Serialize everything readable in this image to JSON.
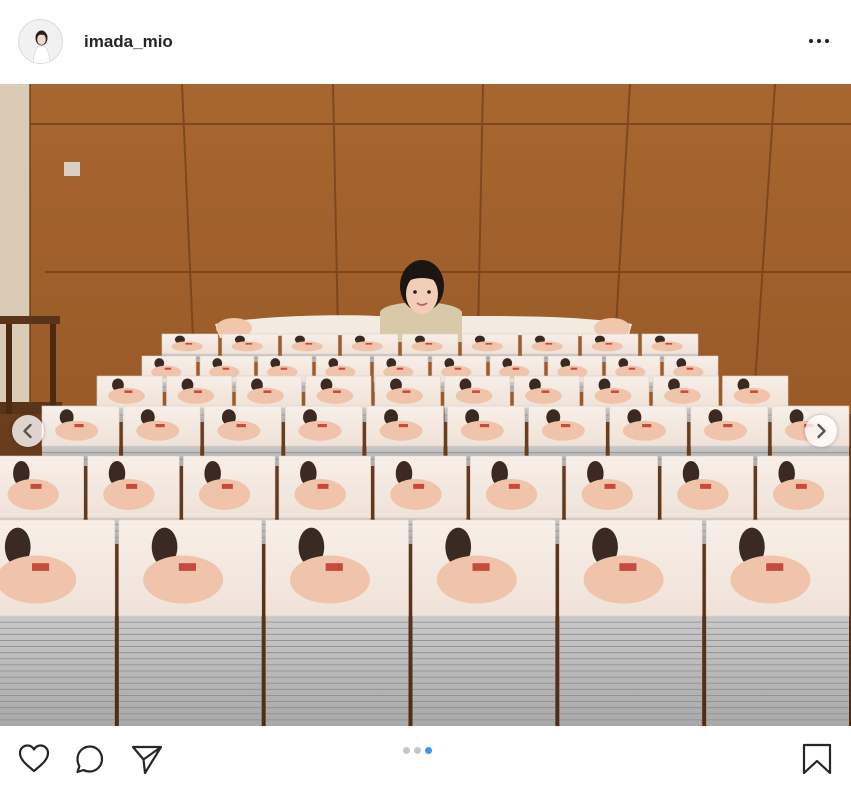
{
  "post": {
    "username": "imada_mio"
  },
  "carousel": {
    "total_slides": 3,
    "active_slide": 3
  },
  "icons": {
    "more": "more-horizontal-icon",
    "prev": "chevron-left-icon",
    "next": "chevron-right-icon",
    "like": "heart-icon",
    "comment": "comment-icon",
    "share": "paper-plane-icon",
    "save": "bookmark-icon"
  },
  "colors": {
    "accent": "#3897f0",
    "text": "#262626",
    "dot_inactive": "#c7c7c7"
  }
}
